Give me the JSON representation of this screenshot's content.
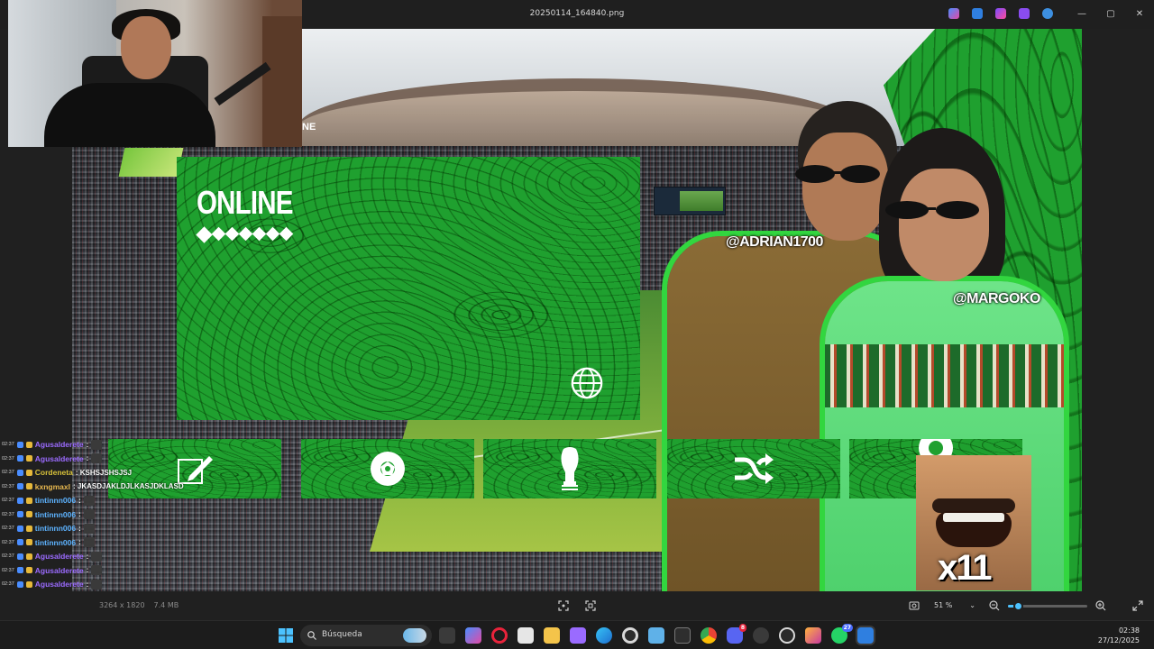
{
  "window": {
    "title": "20250114_164840.png",
    "minimize": "—",
    "maximize": "▢",
    "close": "✕"
  },
  "overlay": {
    "panel_title": "ONLINE",
    "cut_label": "NE",
    "tag_left": "@ADRIAN1700",
    "tag_right": "@MARGOKO",
    "meme_label": "x11",
    "tiles": [
      {
        "icon": "pencil-icon"
      },
      {
        "icon": "ball-icon"
      },
      {
        "icon": "trophy-icon"
      },
      {
        "icon": "shuffle-icon"
      },
      {
        "icon": "ball-icon"
      }
    ]
  },
  "chat": [
    {
      "time": "02:37",
      "user": "Agusalderete",
      "color": "#9b6bff",
      "msg": ":",
      "emote": true
    },
    {
      "time": "02:37",
      "user": "Agusalderete",
      "color": "#9b6bff",
      "msg": ":",
      "emote": true
    },
    {
      "time": "02:37",
      "user": "Cordeneta",
      "color": "#d8c23a",
      "msg": ": KSHSJSHSJSJ",
      "emote": false
    },
    {
      "time": "02:37",
      "user": "kxngmaxl",
      "color": "#e9b94f",
      "msg": ": JKASDJAKLDJLKASJDKLASD",
      "emote": false
    },
    {
      "time": "02:37",
      "user": "tintinnn006",
      "color": "#5db3ff",
      "msg": ":",
      "emote": true
    },
    {
      "time": "02:37",
      "user": "tintinnn006",
      "color": "#5db3ff",
      "msg": ":",
      "emote": true
    },
    {
      "time": "02:37",
      "user": "tintinnn006",
      "color": "#5db3ff",
      "msg": ":",
      "emote": true
    },
    {
      "time": "02:37",
      "user": "tintinnn006",
      "color": "#5db3ff",
      "msg": ":",
      "emote": true
    },
    {
      "time": "02:37",
      "user": "Agusalderete",
      "color": "#9b6bff",
      "msg": ":",
      "emote": true
    },
    {
      "time": "02:37",
      "user": "Agusalderete",
      "color": "#9b6bff",
      "msg": ":",
      "emote": true
    },
    {
      "time": "02:37",
      "user": "Agusalderete",
      "color": "#9b6bff",
      "msg": ":",
      "emote": true
    },
    {
      "time": "02:37",
      "user": "riverplate731_323",
      "color": "#ff3a3a",
      "msg": ":",
      "emote": false
    },
    {
      "time": "02:37",
      "user": "riverplate731_323",
      "color": "#ff3a3a",
      "msg": ":",
      "emote": false
    },
    {
      "time": "02:37",
      "user": "riverplate731_323",
      "color": "#ff3a3a",
      "msg": ":",
      "emote": false
    },
    {
      "time": "02:37",
      "user": "riverplate731_323",
      "color": "#ff3a3a",
      "msg": ":",
      "emote": false
    }
  ],
  "viewer": {
    "dimensions": "3264 x 1820",
    "filesize": "7.4 MB",
    "zoom": "51 %",
    "zoom_level": 0.12
  },
  "taskbar": {
    "search_label": "Búsqueda",
    "time": "02:38",
    "date": "27/12/2025",
    "discord_badge": "8",
    "whatsapp_badge": "27"
  },
  "colors": {
    "accent_green": "#1fa02f",
    "glow_green": "#32d63f",
    "viewer_accent": "#4cc2ff"
  }
}
